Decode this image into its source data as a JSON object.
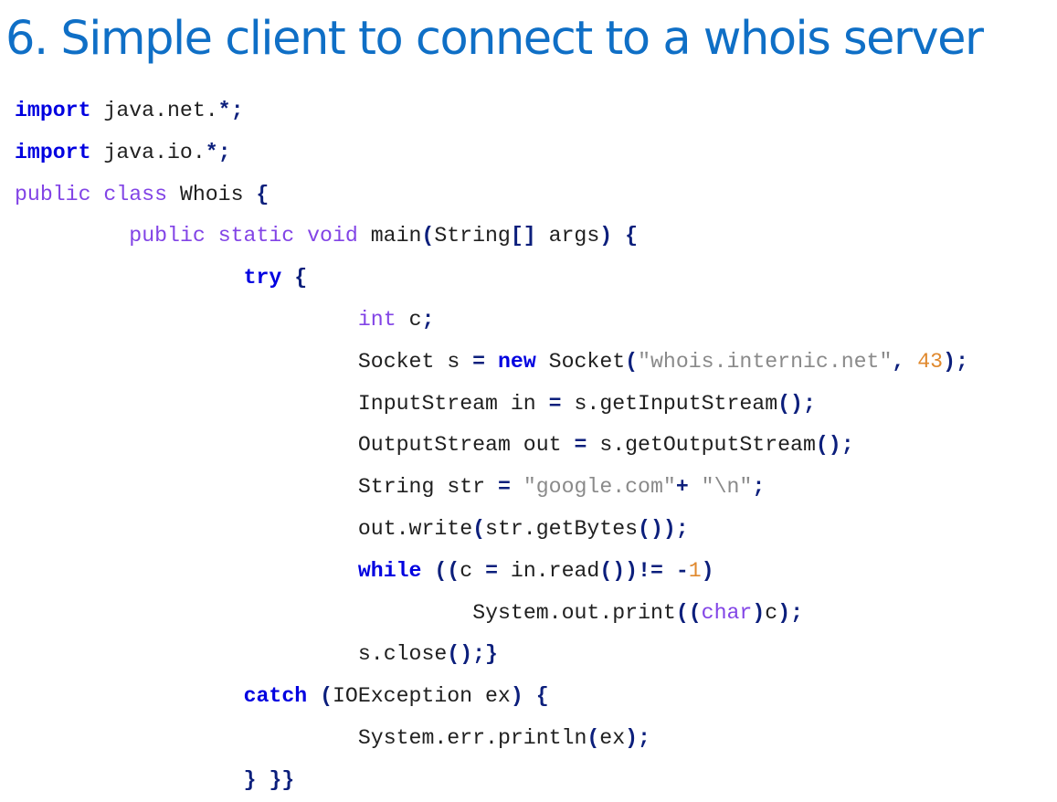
{
  "slide": {
    "title": "6. Simple client to connect to a whois server"
  },
  "code": {
    "language": "java",
    "lines": [
      {
        "indent": 0,
        "tokens": [
          [
            "kw",
            "import"
          ],
          [
            "sp",
            " "
          ],
          [
            "id",
            "java.net."
          ],
          [
            "op",
            "*;"
          ]
        ]
      },
      {
        "indent": 0,
        "tokens": [
          [
            "kw",
            "import"
          ],
          [
            "sp",
            " "
          ],
          [
            "id",
            "java.io."
          ],
          [
            "op",
            "*;"
          ]
        ]
      },
      {
        "indent": 0,
        "tokens": [
          [
            "ty",
            "public"
          ],
          [
            "sp",
            " "
          ],
          [
            "ty",
            "class"
          ],
          [
            "sp",
            " "
          ],
          [
            "id",
            "Whois"
          ],
          [
            "sp",
            " "
          ],
          [
            "op",
            "{"
          ]
        ]
      },
      {
        "indent": 1,
        "tokens": [
          [
            "ty",
            "public"
          ],
          [
            "sp",
            " "
          ],
          [
            "ty",
            "static"
          ],
          [
            "sp",
            " "
          ],
          [
            "ty",
            "void"
          ],
          [
            "sp",
            " "
          ],
          [
            "id",
            "main"
          ],
          [
            "op",
            "("
          ],
          [
            "id",
            "String"
          ],
          [
            "op",
            "[]"
          ],
          [
            "sp",
            " "
          ],
          [
            "id",
            "args"
          ],
          [
            "op",
            ")"
          ],
          [
            "sp",
            " "
          ],
          [
            "op",
            "{"
          ]
        ]
      },
      {
        "indent": 2,
        "tokens": [
          [
            "kw",
            "try"
          ],
          [
            "sp",
            " "
          ],
          [
            "op",
            "{"
          ]
        ]
      },
      {
        "indent": 3,
        "tokens": [
          [
            "ty",
            "int"
          ],
          [
            "sp",
            " "
          ],
          [
            "id",
            "c"
          ],
          [
            "op",
            ";"
          ]
        ]
      },
      {
        "indent": 3,
        "tokens": [
          [
            "id",
            "Socket"
          ],
          [
            "sp",
            " "
          ],
          [
            "id",
            "s"
          ],
          [
            "sp",
            " "
          ],
          [
            "op",
            "="
          ],
          [
            "sp",
            " "
          ],
          [
            "kw",
            "new"
          ],
          [
            "sp",
            " "
          ],
          [
            "id",
            "Socket"
          ],
          [
            "op",
            "("
          ],
          [
            "str",
            "\"whois.internic.net\""
          ],
          [
            "op",
            ","
          ],
          [
            "sp",
            " "
          ],
          [
            "num",
            "43"
          ],
          [
            "op",
            ");"
          ]
        ]
      },
      {
        "indent": 3,
        "tokens": [
          [
            "id",
            "InputStream"
          ],
          [
            "sp",
            " "
          ],
          [
            "id",
            "in"
          ],
          [
            "sp",
            " "
          ],
          [
            "op",
            "="
          ],
          [
            "sp",
            " "
          ],
          [
            "id",
            "s.getInputStream"
          ],
          [
            "op",
            "();"
          ]
        ]
      },
      {
        "indent": 3,
        "tokens": [
          [
            "id",
            "OutputStream"
          ],
          [
            "sp",
            " "
          ],
          [
            "id",
            "out"
          ],
          [
            "sp",
            " "
          ],
          [
            "op",
            "="
          ],
          [
            "sp",
            " "
          ],
          [
            "id",
            "s.getOutputStream"
          ],
          [
            "op",
            "();"
          ]
        ]
      },
      {
        "indent": 3,
        "tokens": [
          [
            "id",
            "String"
          ],
          [
            "sp",
            " "
          ],
          [
            "id",
            "str"
          ],
          [
            "sp",
            " "
          ],
          [
            "op",
            "="
          ],
          [
            "sp",
            " "
          ],
          [
            "str",
            "\"google.com\""
          ],
          [
            "op",
            "+"
          ],
          [
            "sp",
            " "
          ],
          [
            "str",
            "\"\\n\""
          ],
          [
            "op",
            ";"
          ]
        ]
      },
      {
        "indent": 3,
        "tokens": [
          [
            "id",
            "out.write"
          ],
          [
            "op",
            "("
          ],
          [
            "id",
            "str.getBytes"
          ],
          [
            "op",
            "());"
          ]
        ]
      },
      {
        "indent": 3,
        "tokens": [
          [
            "kw",
            "while"
          ],
          [
            "sp",
            " "
          ],
          [
            "op",
            "(("
          ],
          [
            "id",
            "c"
          ],
          [
            "sp",
            " "
          ],
          [
            "op",
            "="
          ],
          [
            "sp",
            " "
          ],
          [
            "id",
            "in.read"
          ],
          [
            "op",
            "())!="
          ],
          [
            "sp",
            " "
          ],
          [
            "op",
            "-"
          ],
          [
            "num",
            "1"
          ],
          [
            "op",
            ")"
          ]
        ]
      },
      {
        "indent": 4,
        "tokens": [
          [
            "id",
            "System.out.print"
          ],
          [
            "op",
            "(("
          ],
          [
            "ty",
            "char"
          ],
          [
            "op",
            ")"
          ],
          [
            "id",
            "c"
          ],
          [
            "op",
            ");"
          ]
        ]
      },
      {
        "indent": 3,
        "tokens": [
          [
            "id",
            "s.close"
          ],
          [
            "op",
            "();}"
          ]
        ]
      },
      {
        "indent": 2,
        "tokens": [
          [
            "kw",
            "catch"
          ],
          [
            "sp",
            " "
          ],
          [
            "op",
            "("
          ],
          [
            "id",
            "IOException"
          ],
          [
            "sp",
            " "
          ],
          [
            "id",
            "ex"
          ],
          [
            "op",
            ")"
          ],
          [
            "sp",
            " "
          ],
          [
            "op",
            "{"
          ]
        ]
      },
      {
        "indent": 3,
        "tokens": [
          [
            "id",
            "System.err.println"
          ],
          [
            "op",
            "("
          ],
          [
            "id",
            "ex"
          ],
          [
            "op",
            ");"
          ]
        ]
      },
      {
        "indent": 2,
        "tokens": [
          [
            "op",
            "}"
          ],
          [
            "sp",
            " "
          ],
          [
            "op",
            "}}"
          ]
        ]
      }
    ]
  }
}
